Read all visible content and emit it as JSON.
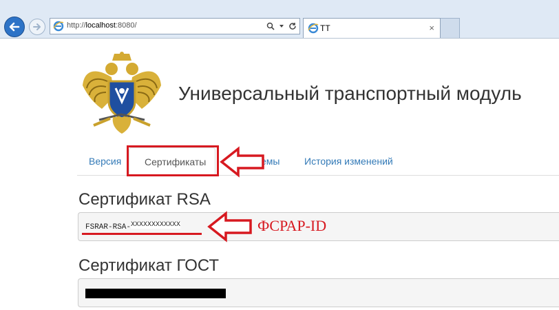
{
  "browser": {
    "url_prefix": "http://",
    "url_host": "localhost",
    "url_rest": ":8080/",
    "tab_title": "TT",
    "tab_close": "×"
  },
  "site": {
    "title": "Универсальный транспортный модуль"
  },
  "nav": {
    "items": [
      "Версия",
      "Сертификаты",
      "XML схемы",
      "История изменений"
    ],
    "active_index": 1
  },
  "certificates": {
    "rsa_heading": "Сертификат RSA",
    "rsa_value_prefix": "FSRAR-RSA-",
    "rsa_value_masked": "XXXXXXXXXXXX",
    "gost_heading": "Сертификат ГОСТ"
  },
  "annotations": {
    "fsrar_label": "ФСРАР-ID",
    "color": "#d71920"
  },
  "colors": {
    "link": "#337ab7",
    "browser_frame": "#dfe9f5",
    "back_button": "#2d73c7"
  }
}
